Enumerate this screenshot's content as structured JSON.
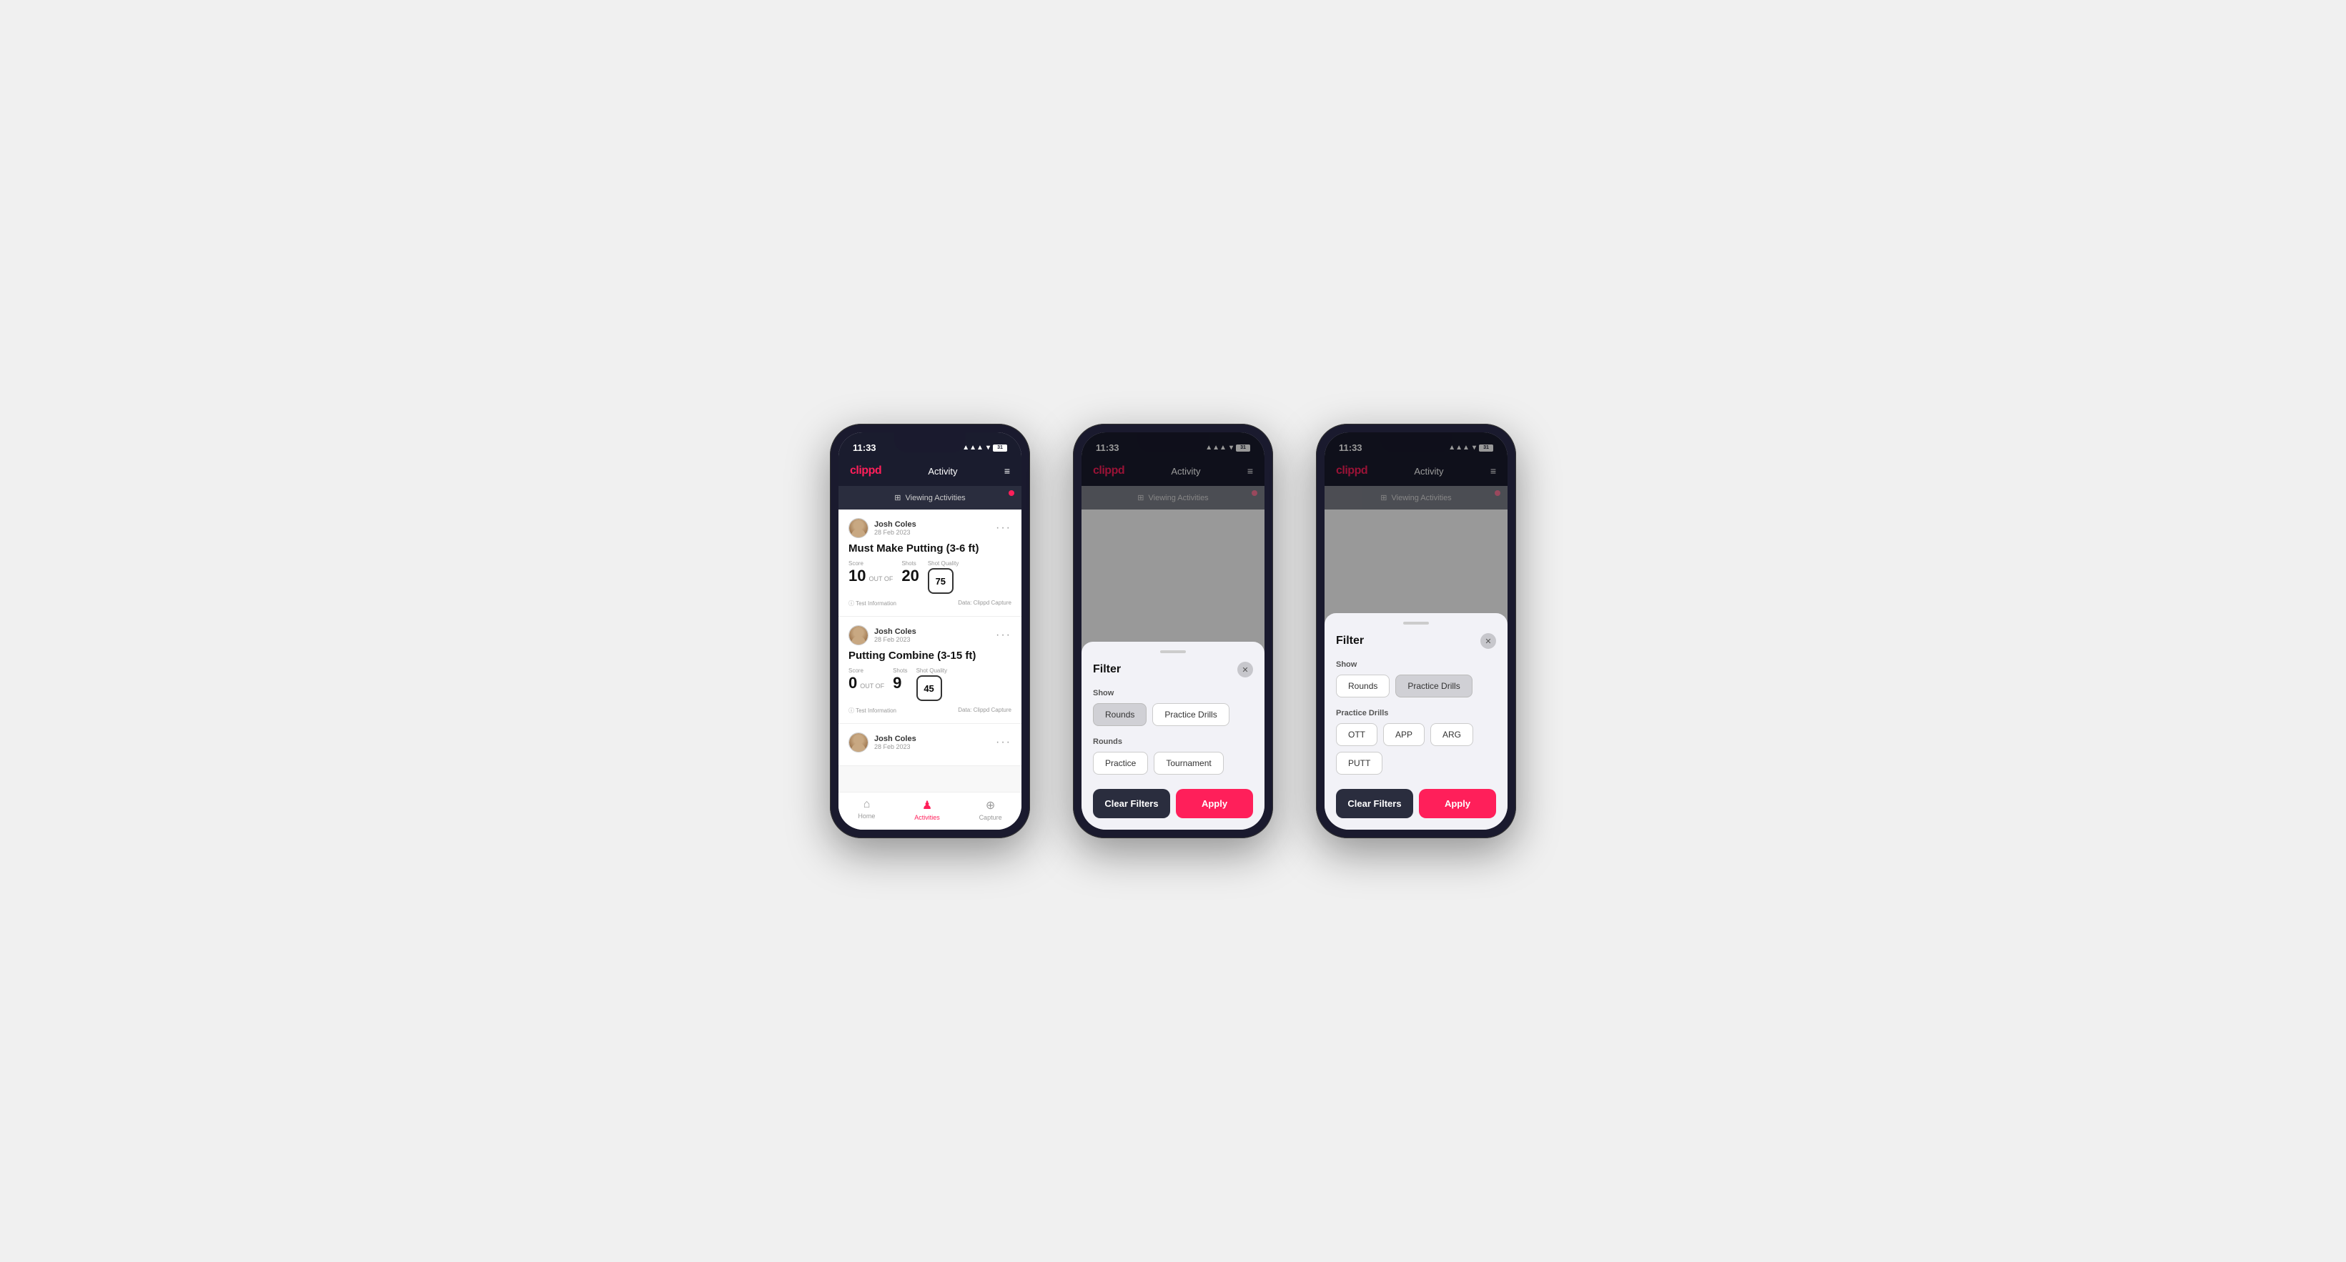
{
  "phones": [
    {
      "id": "phone1",
      "status": {
        "time": "11:33",
        "signal": "▲▲▲",
        "wifi": "WiFi",
        "battery": "31"
      },
      "header": {
        "logo": "clippd",
        "title": "Activity",
        "menu_icon": "≡"
      },
      "viewing_bar": "Viewing Activities",
      "activities": [
        {
          "user_name": "Josh Coles",
          "user_date": "28 Feb 2023",
          "title": "Must Make Putting (3-6 ft)",
          "score_label": "Score",
          "score": "10",
          "shots_label": "Shots",
          "shots": "20",
          "quality_label": "Shot Quality",
          "quality": "75",
          "footer_left": "ⓘ Test Information",
          "footer_right": "Data: Clippd Capture"
        },
        {
          "user_name": "Josh Coles",
          "user_date": "28 Feb 2023",
          "title": "Putting Combine (3-15 ft)",
          "score_label": "Score",
          "score": "0",
          "shots_label": "Shots",
          "shots": "9",
          "quality_label": "Shot Quality",
          "quality": "45",
          "footer_left": "ⓘ Test Information",
          "footer_right": "Data: Clippd Capture"
        },
        {
          "user_name": "Josh Coles",
          "user_date": "28 Feb 2023",
          "title": "",
          "score_label": "",
          "score": "",
          "shots_label": "",
          "shots": "",
          "quality_label": "",
          "quality": "",
          "footer_left": "",
          "footer_right": ""
        }
      ],
      "nav": {
        "items": [
          {
            "label": "Home",
            "icon": "⌂",
            "active": false
          },
          {
            "label": "Activities",
            "icon": "♟",
            "active": true
          },
          {
            "label": "Capture",
            "icon": "⊕",
            "active": false
          }
        ]
      },
      "has_filter": false
    },
    {
      "id": "phone2",
      "status": {
        "time": "11:33",
        "battery": "31"
      },
      "header": {
        "logo": "clippd",
        "title": "Activity",
        "menu_icon": "≡"
      },
      "viewing_bar": "Viewing Activities",
      "has_filter": true,
      "filter": {
        "title": "Filter",
        "show_label": "Show",
        "show_options": [
          {
            "label": "Rounds",
            "active": true
          },
          {
            "label": "Practice Drills",
            "active": false
          }
        ],
        "rounds_label": "Rounds",
        "rounds_options": [
          {
            "label": "Practice",
            "active": false
          },
          {
            "label": "Tournament",
            "active": false
          }
        ],
        "drills_label": null,
        "drills_options": null,
        "clear_label": "Clear Filters",
        "apply_label": "Apply"
      }
    },
    {
      "id": "phone3",
      "status": {
        "time": "11:33",
        "battery": "31"
      },
      "header": {
        "logo": "clippd",
        "title": "Activity",
        "menu_icon": "≡"
      },
      "viewing_bar": "Viewing Activities",
      "has_filter": true,
      "filter": {
        "title": "Filter",
        "show_label": "Show",
        "show_options": [
          {
            "label": "Rounds",
            "active": false
          },
          {
            "label": "Practice Drills",
            "active": true
          }
        ],
        "rounds_label": null,
        "rounds_options": null,
        "drills_label": "Practice Drills",
        "drills_options": [
          {
            "label": "OTT",
            "active": false
          },
          {
            "label": "APP",
            "active": false
          },
          {
            "label": "ARG",
            "active": false
          },
          {
            "label": "PUTT",
            "active": false
          }
        ],
        "clear_label": "Clear Filters",
        "apply_label": "Apply"
      }
    }
  ]
}
